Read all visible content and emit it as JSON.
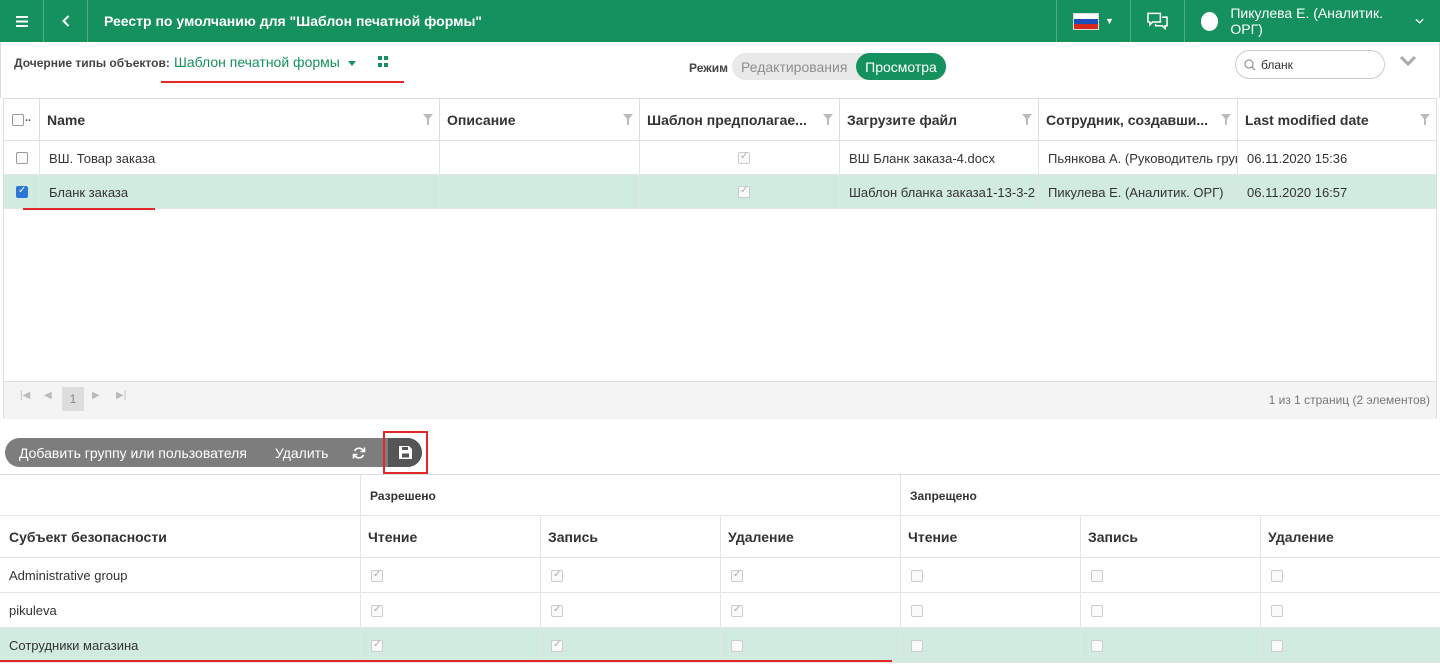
{
  "topbar": {
    "title": "Реестр по умолчанию для \"Шаблон печатной формы\"",
    "user": "Пикулева Е. (Аналитик. ОРГ)",
    "accent": "#15915d"
  },
  "subheader": {
    "child_types_label": "Дочерние типы объектов:",
    "child_type_value": "Шаблон печатной формы",
    "mode_label": "Режим",
    "mode_edit": "Редактирования",
    "mode_view": "Просмотра",
    "search_value": "бланк"
  },
  "grid": {
    "columns": [
      "Name",
      "Описание",
      "Шаблон предполагае...",
      "Загрузите файл",
      "Сотрудник, создавши...",
      "Last modified date"
    ],
    "rows": [
      {
        "name": "ВШ. Товар заказа",
        "description": "",
        "checked": false,
        "template": true,
        "file": "ВШ Бланк заказа-4.docx",
        "employee": "Пьянкова А. (Руководитель груп",
        "modified": "06.11.2020 15:36"
      },
      {
        "name": "Бланк заказа",
        "description": "",
        "checked": true,
        "template": true,
        "file": "Шаблон бланка заказа1-13-3-2",
        "employee": "Пикулева Е. (Аналитик. ОРГ)",
        "modified": "06.11.2020 16:57"
      }
    ]
  },
  "pager": {
    "current_page": "1",
    "info": "1 из 1 страниц (2 элементов)"
  },
  "toolbar2": {
    "add_label": "Добавить группу или пользователя",
    "delete_label": "Удалить"
  },
  "permissions": {
    "group_allowed": "Разрешено",
    "group_denied": "Запрещено",
    "subject_header": "Субъект безопасности",
    "col_read": "Чтение",
    "col_write": "Запись",
    "col_delete": "Удаление",
    "rows": [
      {
        "subject": "Administrative group",
        "allow": [
          true,
          true,
          true
        ],
        "deny": [
          false,
          false,
          false
        ]
      },
      {
        "subject": "pikuleva",
        "allow": [
          true,
          true,
          true
        ],
        "deny": [
          false,
          false,
          false
        ]
      },
      {
        "subject": "Сотрудники магазина",
        "allow": [
          true,
          true,
          false
        ],
        "deny": [
          false,
          false,
          false
        ]
      }
    ]
  }
}
